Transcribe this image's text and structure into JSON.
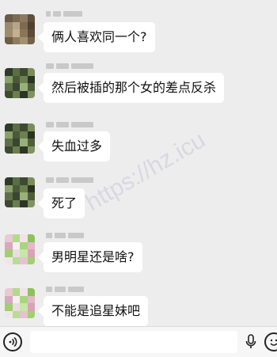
{
  "watermark": "https://hz.icu",
  "messages": [
    {
      "text": "俩人喜欢同一个?",
      "avatar_colors": [
        "#6b5a45",
        "#7a6b52",
        "#8c7a60",
        "#5e4f3d",
        "#9a8a70",
        "#b8a588",
        "#7d6a50",
        "#4f4030",
        "#a08c6c",
        "#c4b090",
        "#8a7558",
        "#5a4a38",
        "#6e5c45",
        "#8f7b5f",
        "#a39070",
        "#72604a"
      ]
    },
    {
      "text": "然后被插的那个女的差点反杀",
      "avatar_colors": [
        "#2f3a28",
        "#5a6e44",
        "#3e4a30",
        "#7a8c5c",
        "#8aa06a",
        "#4a5a38",
        "#6c8050",
        "#2a3322",
        "#5e7048",
        "#3a4630",
        "#98b07a",
        "#4e5e3a",
        "#3d4a2e",
        "#6a7e4e",
        "#2c3626",
        "#7e9460"
      ]
    },
    {
      "text": "失血过多",
      "avatar_colors": [
        "#2f3a28",
        "#5a6e44",
        "#3e4a30",
        "#7a8c5c",
        "#8aa06a",
        "#4a5a38",
        "#6c8050",
        "#2a3322",
        "#5e7048",
        "#3a4630",
        "#98b07a",
        "#4e5e3a",
        "#3d4a2e",
        "#6a7e4e",
        "#2c3626",
        "#7e9460"
      ]
    },
    {
      "text": "死了",
      "avatar_colors": [
        "#2f3a28",
        "#5a6e44",
        "#3e4a30",
        "#7a8c5c",
        "#8aa06a",
        "#4a5a38",
        "#6c8050",
        "#2a3322",
        "#5e7048",
        "#3a4630",
        "#98b07a",
        "#4e5e3a",
        "#3d4a2e",
        "#6a7e4e",
        "#2c3626",
        "#7e9460"
      ]
    },
    {
      "text": "男明星还是啥?",
      "avatar_colors": [
        "#e8c9d4",
        "#b5d98a",
        "#f2e2ea",
        "#8cc25a",
        "#d7a8be",
        "#f5f0f2",
        "#a9d57c",
        "#e3b8c9",
        "#9fcf6e",
        "#eadce3",
        "#c7e6a8",
        "#d9a2b8",
        "#f0e6ea",
        "#b8dc94",
        "#e6c2d0",
        "#a2d070"
      ]
    },
    {
      "text": "不能是追星妹吧",
      "avatar_colors": [
        "#e8c9d4",
        "#b5d98a",
        "#f2e2ea",
        "#8cc25a",
        "#d7a8be",
        "#f5f0f2",
        "#a9d57c",
        "#e3b8c9",
        "#9fcf6e",
        "#eadce3",
        "#c7e6a8",
        "#d9a2b8",
        "#f0e6ea",
        "#b8dc94",
        "#e6c2d0",
        "#a2d070"
      ]
    }
  ]
}
